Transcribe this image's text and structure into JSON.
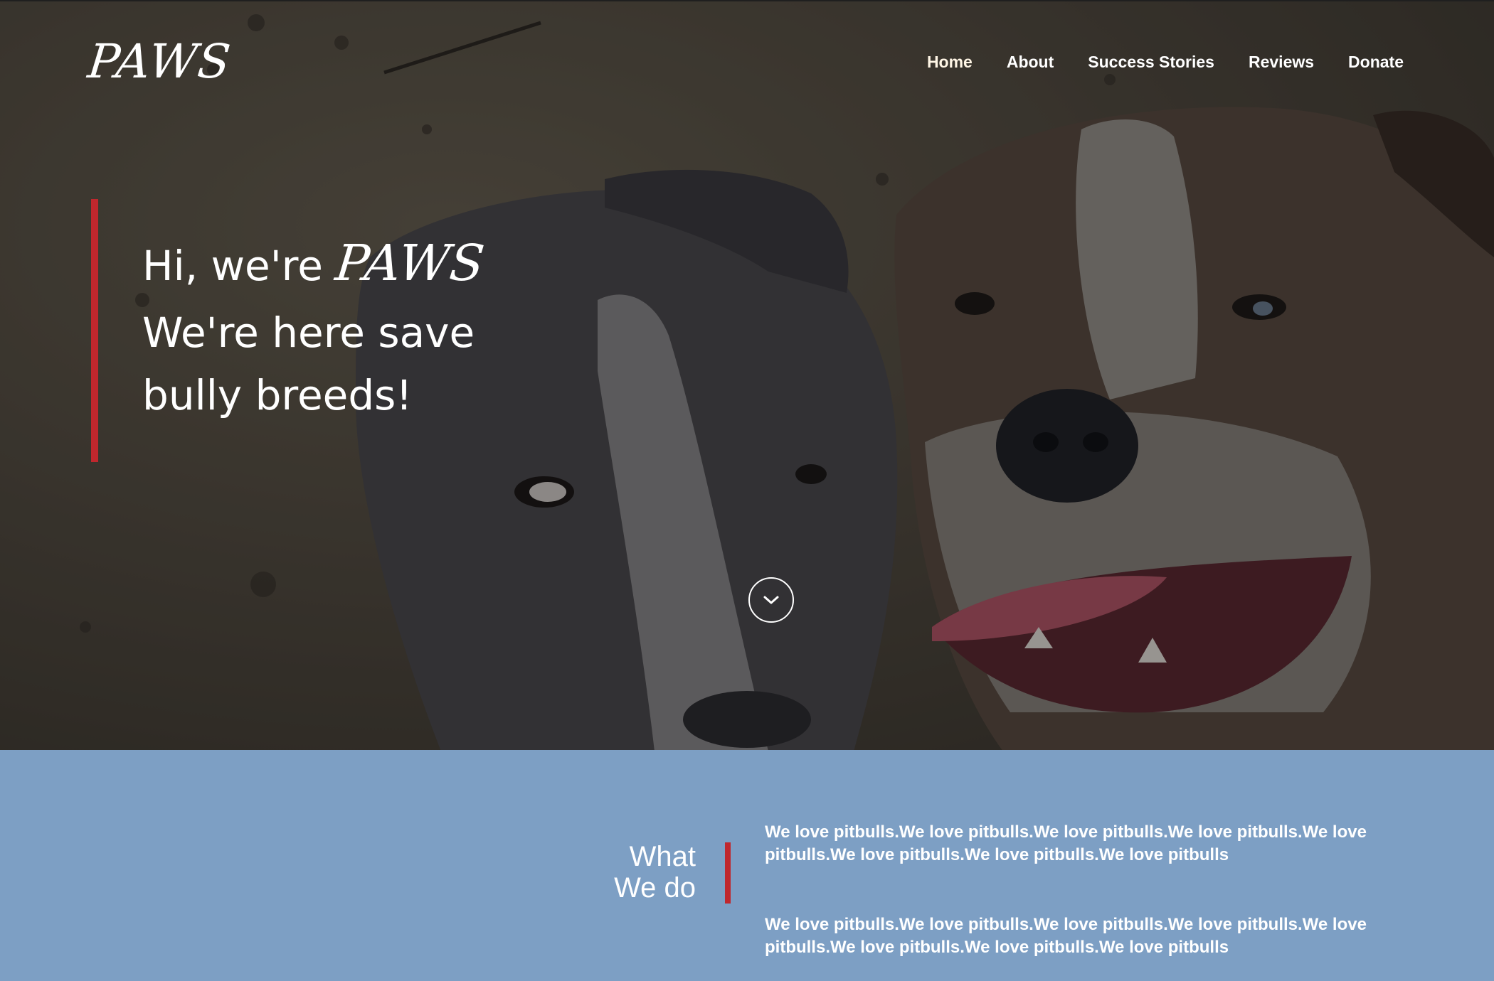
{
  "brand": "PAWS",
  "nav": {
    "items": [
      {
        "label": "Home"
      },
      {
        "label": "About"
      },
      {
        "label": "Success Stories"
      },
      {
        "label": "Reviews"
      },
      {
        "label": "Donate"
      }
    ]
  },
  "hero": {
    "greeting": "Hi, we're ",
    "brand": "PAWS",
    "tagline_line1": "We're here save",
    "tagline_line2": "bully breeds!",
    "scroll_icon": "chevron-down-icon"
  },
  "what_we_do": {
    "title_line1": "What",
    "title_line2": "We do",
    "paragraphs": [
      "We love pitbulls.We love pitbulls.We love pitbulls.We love pitbulls.We love pitbulls.We love pitbulls.We love pitbulls.We love pitbulls",
      "We love pitbulls.We love pitbulls.We love pitbulls.We love pitbulls.We love pitbulls.We love pitbulls.We love pitbulls.We love pitbulls"
    ]
  },
  "colors": {
    "accent": "#c0272d",
    "section_bg": "#7d9fc4",
    "text": "#ffffff"
  }
}
